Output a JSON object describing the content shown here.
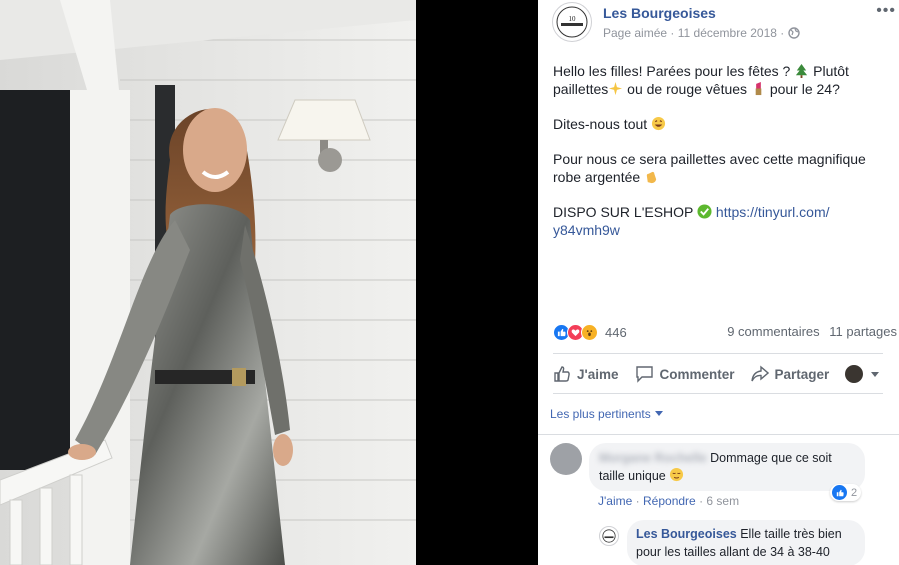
{
  "post": {
    "page_name": "Les Bourgeoises",
    "status": "Page aimée",
    "date": "11 décembre 2018",
    "separator": "·",
    "more": "•••",
    "avatar_text": "LES BOURGEOISES",
    "paragraphs": {
      "p1a": "Hello les filles! Parées pour les fêtes ?",
      "p1b": "Plutôt",
      "p1c": "paillettes",
      "p1d": "ou de rouge vêtues",
      "p1e": "pour le 24?",
      "p2": "Dites-nous tout",
      "p3a": "Pour nous ce sera paillettes avec cette magnifique",
      "p3b": "robe argentée",
      "p4a": "DISPO SUR L'ESHOP",
      "p4_link1": "https://tinyurl.com/",
      "p4_link2": "y84vmh9w"
    }
  },
  "stats": {
    "reaction_count": "446",
    "comments": "9 commentaires",
    "shares": "11 partages"
  },
  "actions": {
    "like": "J'aime",
    "comment": "Commenter",
    "share": "Partager"
  },
  "sort_label": "Les plus pertinents",
  "comments": [
    {
      "author": "Morgane Rochelle",
      "text_a": "Dommage que ce soit",
      "text_b": "taille unique",
      "like": "J'aime",
      "reply": "Répondre",
      "time": "6 sem",
      "likes": "2"
    }
  ],
  "reply": {
    "author": "Les Bourgeoises",
    "text_a": "Elle taille très bien",
    "text_b": "pour les tailles allant de 34 à 38-40"
  },
  "colors": {
    "link": "#365899",
    "like_blue": "#1877f2",
    "love_red": "#f33e58",
    "wow_yellow": "#f7b125"
  }
}
